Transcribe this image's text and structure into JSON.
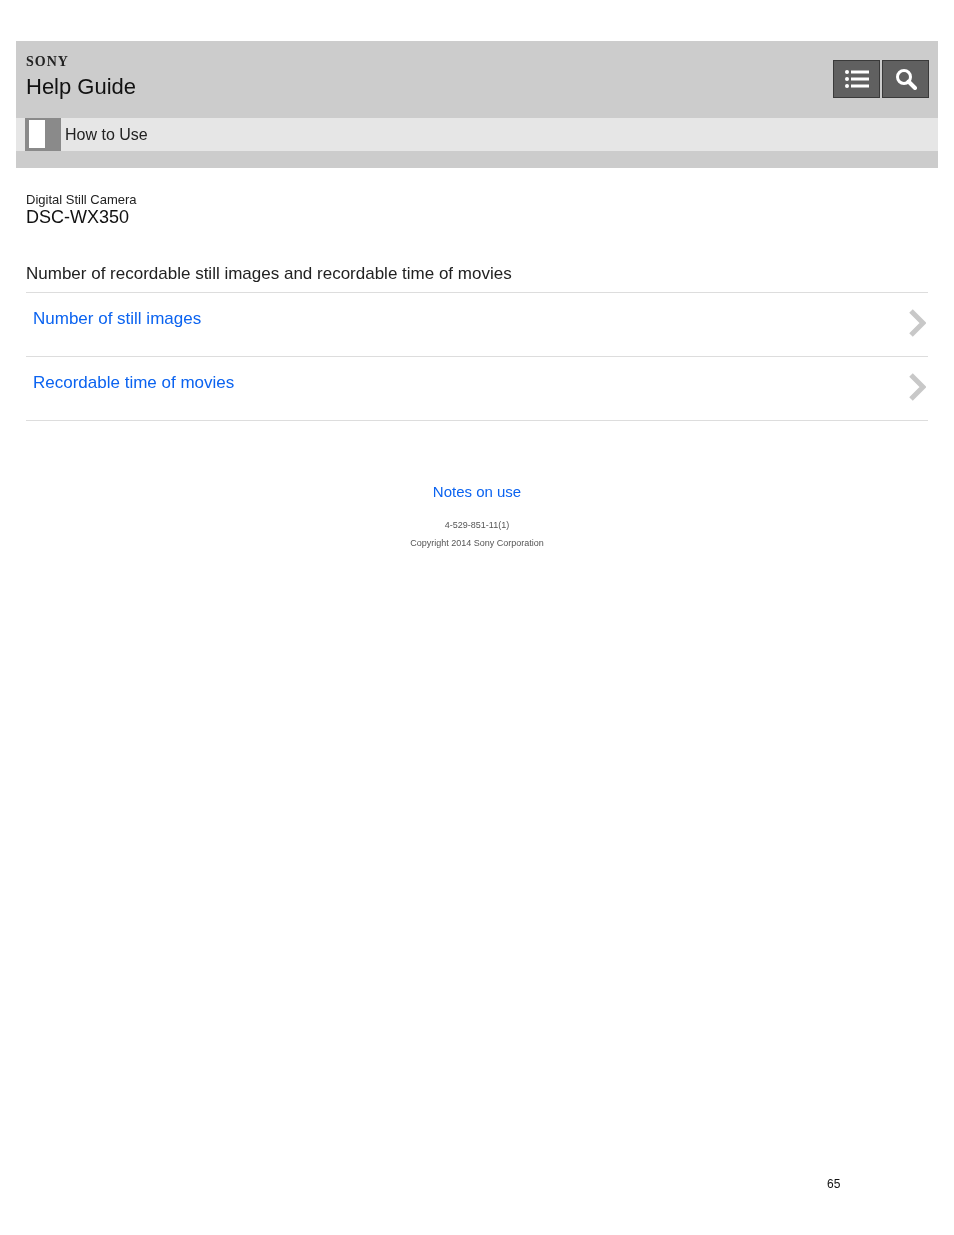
{
  "header": {
    "brand": "SONY",
    "title": "Help Guide",
    "buttons": [
      {
        "kind": "list"
      },
      {
        "kind": "search"
      }
    ],
    "category": "How to Use"
  },
  "product": {
    "category": "Digital Still Camera",
    "model": "DSC-WX350"
  },
  "page_title": "Number of recordable still images and recordable time of movies",
  "links": [
    {
      "label": "Number of still images"
    },
    {
      "label": "Recordable time of movies"
    }
  ],
  "footer": {
    "notes_link": "Notes on use",
    "doc_number": "4-529-851-11(1)",
    "copyright": "Copyright 2014 Sony Corporation"
  },
  "page_number": "65"
}
